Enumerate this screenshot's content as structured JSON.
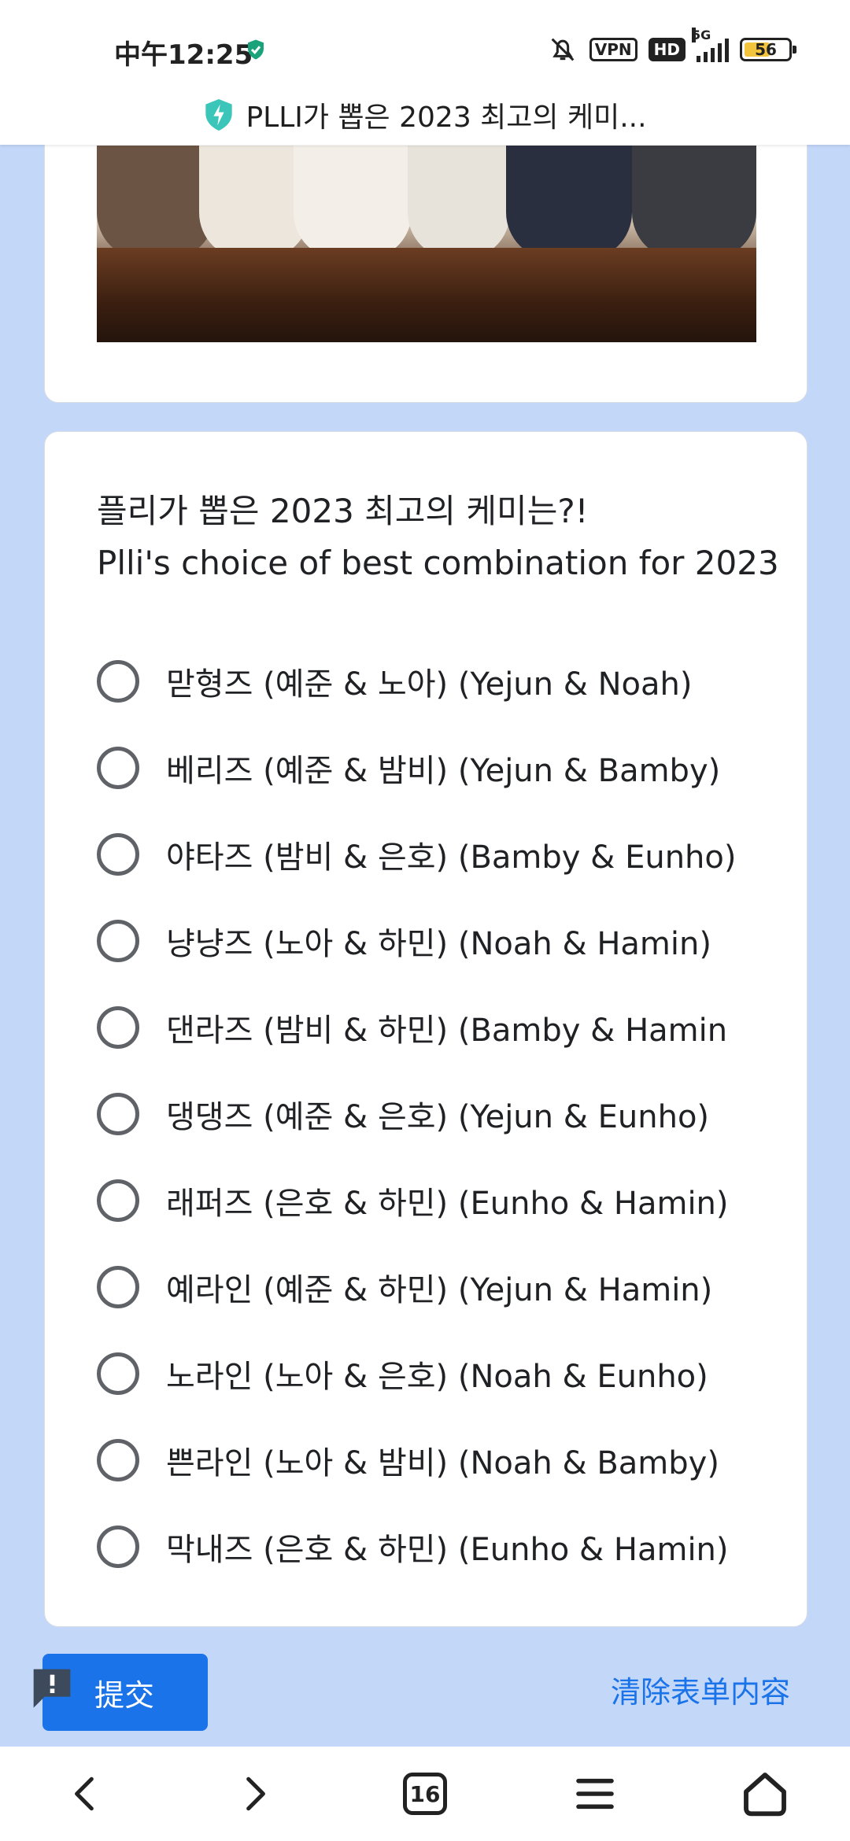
{
  "status_bar": {
    "time": "中午12:25",
    "vpn_label": "VPN",
    "hd_label": "HD",
    "network": "5G",
    "battery_level": "56"
  },
  "browser": {
    "page_title": "PLLI가 뽑은 2023 최고의 케미...",
    "tab_count": "16"
  },
  "question": {
    "title_ko": "플리가 뽑은 2023 최고의 케미는?!",
    "title_en": "Plli's choice of best combination for 2023",
    "options": [
      {
        "label": "맏형즈  (예준 & 노아) (Yejun & Noah)"
      },
      {
        "label": "베리즈  (예준 & 밤비)  (Yejun & Bamby)"
      },
      {
        "label": "야타즈  (밤비 & 은호)  (Bamby & Eunho)"
      },
      {
        "label": "냥냥즈  (노아 & 하민)  (Noah & Hamin)"
      },
      {
        "label": "댄라즈  (밤비 & 하민) (Bamby & Hamin"
      },
      {
        "label": "댕댕즈  (예준 & 은호) (Yejun & Eunho)"
      },
      {
        "label": "래퍼즈  (은호 & 하민) (Eunho & Hamin)"
      },
      {
        "label": "예라인  (예준 & 하민) (Yejun & Hamin)"
      },
      {
        "label": "노라인  (노아 & 은호) (Noah & Eunho)"
      },
      {
        "label": "쁜라인  (노아 & 밤비) (Noah & Bamby)"
      },
      {
        "label": "막내즈  (은호 & 하민) (Eunho & Hamin)"
      }
    ]
  },
  "form": {
    "submit_label": "提交",
    "clear_label": "清除表单内容"
  },
  "colors": {
    "page_background": "#c3d7f8",
    "accent": "#1a73e8"
  }
}
